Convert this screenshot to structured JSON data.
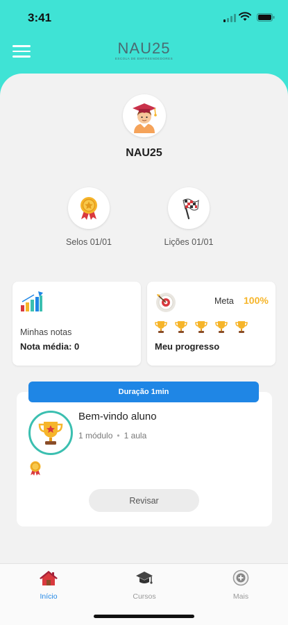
{
  "status_bar": {
    "time": "3:41"
  },
  "header": {
    "logo_name": "NAU25",
    "logo_tagline": "ESCOLA DE EMPREENDEDORES"
  },
  "profile": {
    "username": "NAU25"
  },
  "achievements": [
    {
      "label": "Selos 01/01",
      "icon": "medal-icon"
    },
    {
      "label": "Lições 01/01",
      "icon": "checkered-flag-icon"
    }
  ],
  "notes_card": {
    "label": "Minhas notas",
    "average": "Nota média: 0"
  },
  "progress_card": {
    "meta_label": "Meta",
    "meta_value": "100%",
    "title": "Meu progresso",
    "trophy_count": 5
  },
  "course": {
    "duration": "Duração 1min",
    "title": "Bem-vindo aluno",
    "modules": "1 módulo",
    "separator": "•",
    "lessons": "1 aula",
    "review_button": "Revisar"
  },
  "tabs": [
    {
      "label": "Início",
      "icon": "home-icon",
      "active": true
    },
    {
      "label": "Cursos",
      "icon": "graduation-cap-icon",
      "active": false
    },
    {
      "label": "Mais",
      "icon": "plus-circle-icon",
      "active": false
    }
  ],
  "colors": {
    "accent": "#3fe3d5",
    "primary": "#1f86e5",
    "gold": "#f6b52a",
    "background": "#f2f2f2"
  }
}
